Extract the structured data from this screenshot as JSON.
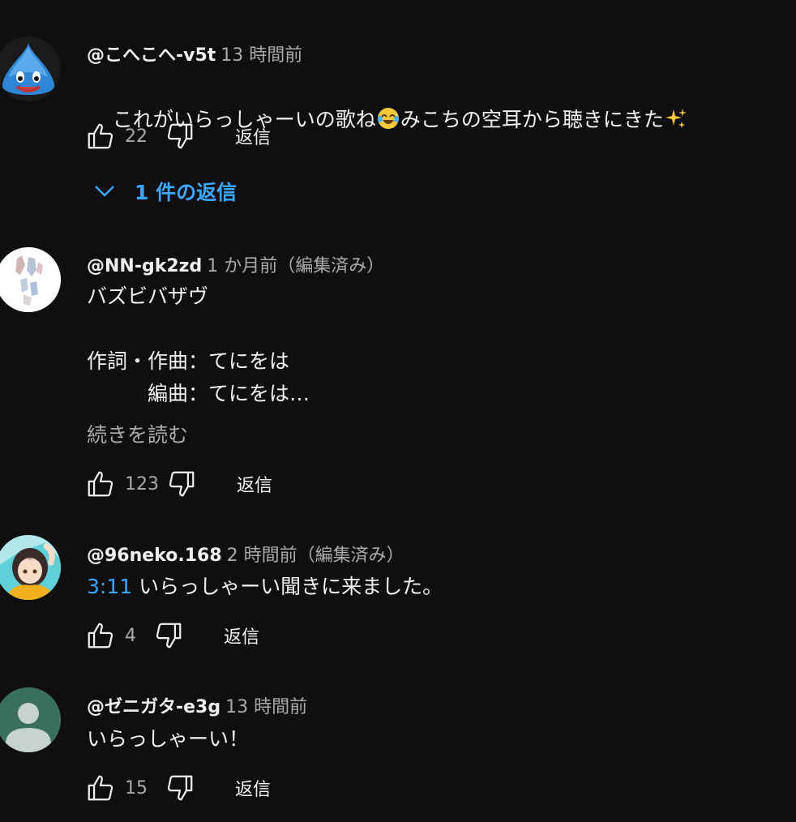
{
  "comments": [
    {
      "author": "@こへこへ-v5t",
      "meta": "13 時間前",
      "lines": [
        "これがいらっしゃーいの歌ね",
        "みこちの空耳から聴きにきた"
      ],
      "likes": "22",
      "reply_label": "返信",
      "replies_toggle": "1 件の返信",
      "avatar": "slime-avatar"
    },
    {
      "author": "@NN-gk2zd",
      "meta": "1 か月前（編集済み）",
      "text": "バズビバザヴ\n\n作詞・作曲：てにをは\n　　　編曲：てにをは…",
      "read_more": "続きを読む",
      "likes": "123",
      "reply_label": "返信",
      "avatar": "illustration-avatar"
    },
    {
      "author": "@96neko.168",
      "meta": "2 時間前（編集済み）",
      "timestamp": "3:11",
      "text": " いらっしゃーい聞きに来ました。",
      "likes": "4",
      "reply_label": "返信",
      "avatar": "anime-girl-avatar"
    },
    {
      "author": "@ゼニガタ-e3g",
      "meta": "13 時間前",
      "text": "いらっしゃーい！",
      "likes": "15",
      "reply_label": "返信",
      "avatar": "default-user-avatar"
    }
  ],
  "colors": {
    "background": "#0f0f0f",
    "text": "#f1f1f1",
    "muted": "#aaaaaa",
    "accent": "#3ea6ff"
  }
}
